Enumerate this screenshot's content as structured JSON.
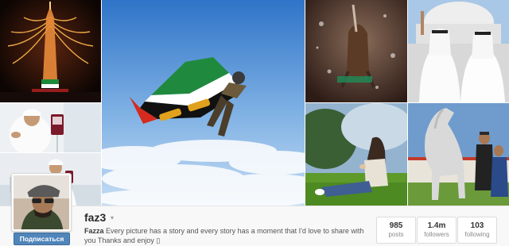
{
  "profile": {
    "username": "faz3",
    "bio_name": "Fazza",
    "bio_text": " Every picture has a story and every story has a moment that I'd love to share with you Thanks and enjoy ▯",
    "follow_label": "Подписаться"
  },
  "stats": {
    "posts": {
      "value": "985",
      "label": "posts"
    },
    "followers": {
      "value": "1.4m",
      "label": "followers"
    },
    "following": {
      "value": "103",
      "label": "following"
    }
  },
  "colors": {
    "follow_button": "#4f85b9",
    "page_background": "#f8f8f8"
  },
  "icons": {
    "username_caret": "▾"
  }
}
